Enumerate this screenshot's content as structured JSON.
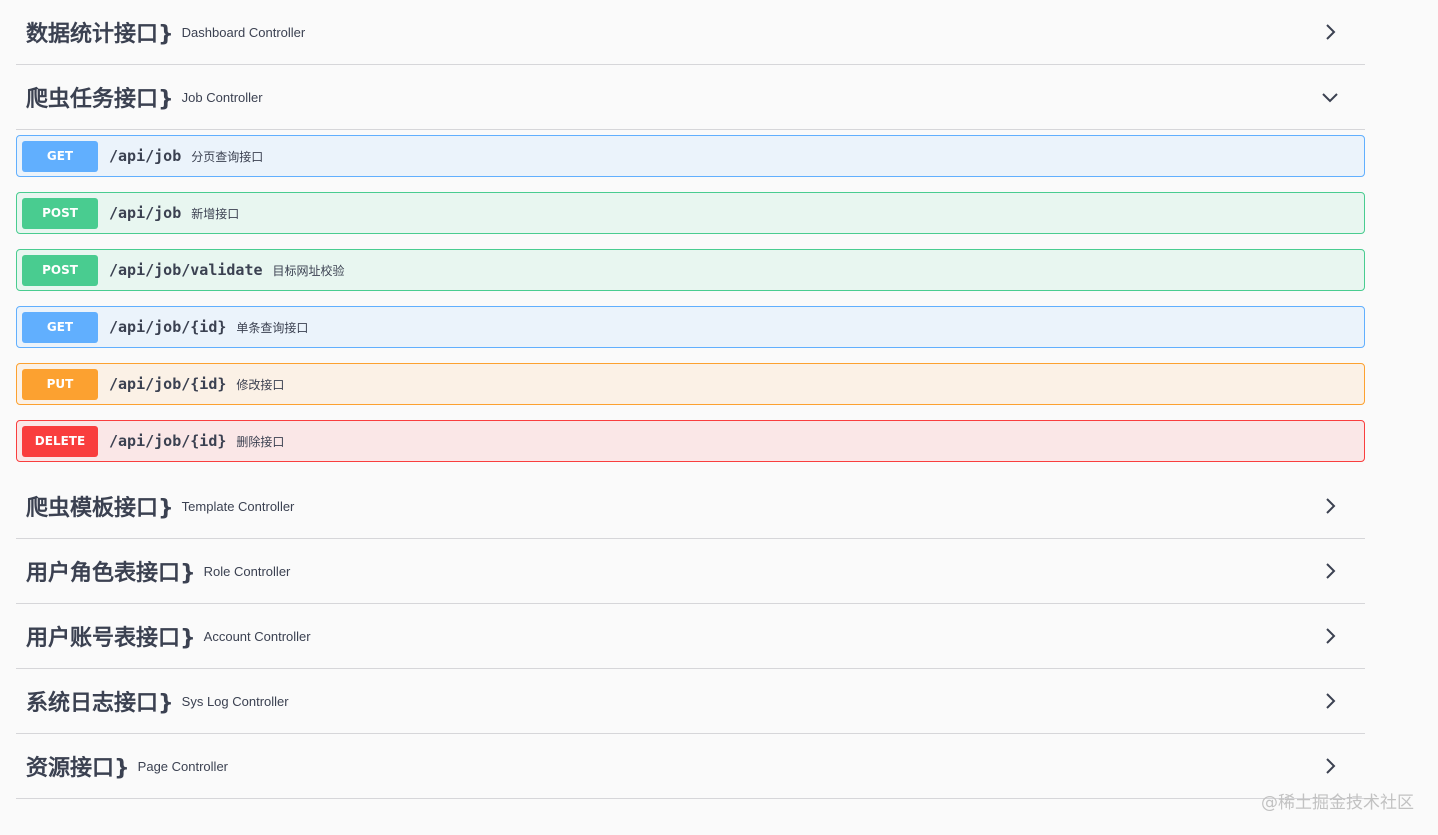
{
  "sections": [
    {
      "title": "数据统计接口}",
      "desc": "Dashboard Controller"
    },
    {
      "title": "爬虫任务接口}",
      "desc": "Job Controller"
    },
    {
      "title": "爬虫模板接口}",
      "desc": "Template Controller"
    },
    {
      "title": "用户角色表接口}",
      "desc": "Role Controller"
    },
    {
      "title": "用户账号表接口}",
      "desc": "Account Controller"
    },
    {
      "title": "系统日志接口}",
      "desc": "Sys Log Controller"
    },
    {
      "title": "资源接口}",
      "desc": "Page Controller"
    }
  ],
  "operations": [
    {
      "method": "GET",
      "path": "/api/job",
      "summary": "分页查询接口"
    },
    {
      "method": "POST",
      "path": "/api/job",
      "summary": "新增接口"
    },
    {
      "method": "POST",
      "path": "/api/job/validate",
      "summary": "目标网址校验"
    },
    {
      "method": "GET",
      "path": "/api/job/{id}",
      "summary": "单条查询接口"
    },
    {
      "method": "PUT",
      "path": "/api/job/{id}",
      "summary": "修改接口"
    },
    {
      "method": "DELETE",
      "path": "/api/job/{id}",
      "summary": "删除接口"
    }
  ],
  "watermark": "@稀土掘金技术社区",
  "icons": {
    "collapsed": "chevron-right-icon",
    "expanded": "chevron-down-icon"
  },
  "colors": {
    "get": "#61affe",
    "post": "#49cc90",
    "put": "#fca130",
    "delete": "#f93e3e"
  }
}
